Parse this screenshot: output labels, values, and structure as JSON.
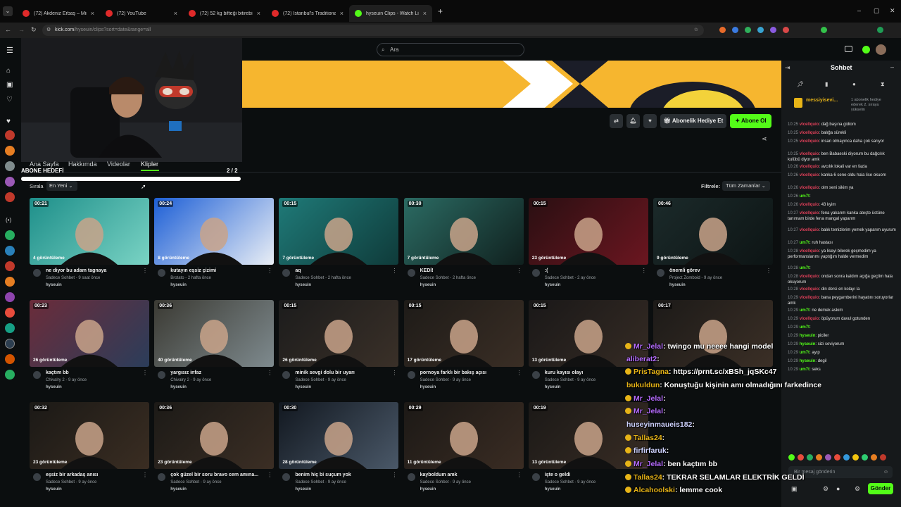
{
  "browser": {
    "tabs": [
      {
        "label": "(72) Akdeniz Erbaş – Miraçlam..",
        "icon": "youtube-icon"
      },
      {
        "label": "(72) YouTube",
        "icon": "youtube-icon"
      },
      {
        "label": "(72) 52 kg bifteği bitirebilir mi..",
        "icon": "youtube-icon"
      },
      {
        "label": "(72) Istanbul's Traditional Dishe..",
        "icon": "youtube-icon"
      },
      {
        "label": "hyseuin Clips - Watch Live on K..",
        "icon": "kick-icon"
      }
    ],
    "url_host": "kick.com",
    "url_path": "/hyseuin/clips?sort=date&range=all"
  },
  "site": {
    "search_placeholder": "Ara"
  },
  "channel": {
    "tabs": [
      "Ana Sayfa",
      "Hakkımda",
      "Videolar",
      "Klipler"
    ],
    "active_tab": "Klipler",
    "sub_goal_label": "ABONE HEDEFİ",
    "sub_goal_count": "2 / 2",
    "sub_goal_progress": 1.0,
    "gift_button": "Abonelik Hediye Et",
    "subscribe_button": "Abone Ol",
    "sort_label": "Sırala",
    "sort_value": "En Yeni",
    "filter_label": "Filtrele:",
    "filter_value": "Tüm Zamanlar"
  },
  "clips": [
    {
      "duration": "00:21",
      "views": "4 görüntüleme",
      "title": "ne diyor bu adam tagnaya",
      "meta": "Sadece Sohbet - 9 saat önce",
      "user": "hyseuin"
    },
    {
      "duration": "00:24",
      "views": "8 görüntüleme",
      "title": "kutayın eşsiz çizimi",
      "meta": "Brotato - 2 hafta önce",
      "user": "hyseuin"
    },
    {
      "duration": "00:15",
      "views": "7 görüntüleme",
      "title": "aq",
      "meta": "Sadece Sohbet - 2 hafta önce",
      "user": "hyseuin"
    },
    {
      "duration": "00:30",
      "views": "7 görüntüleme",
      "title": "KEDİ!",
      "meta": "Sadece Sohbet - 2 hafta önce",
      "user": "hyseuin"
    },
    {
      "duration": "00:15",
      "views": "23 görüntüleme",
      "title": ":(",
      "meta": "Sadece Sohbet - 2 ay önce",
      "user": "hyseuin"
    },
    {
      "duration": "00:46",
      "views": "9 görüntüleme",
      "title": "önemli görev",
      "meta": "Project Zomboid - 9 ay önce",
      "user": "hyseuin"
    },
    {
      "duration": "00:23",
      "views": "26 görüntüleme",
      "title": "kaçtım bb",
      "meta": "Chivalry 2 - 9 ay önce",
      "user": "hyseuin"
    },
    {
      "duration": "00:36",
      "views": "40 görüntüleme",
      "title": "yargısız infaz",
      "meta": "Chivalry 2 - 9 ay önce",
      "user": "hyseuin"
    },
    {
      "duration": "00:15",
      "views": "26 görüntüleme",
      "title": "minik sevgi dolu bir uyarı",
      "meta": "Sadece Sohbet - 9 ay önce",
      "user": "hyseuin"
    },
    {
      "duration": "00:15",
      "views": "17 görüntüleme",
      "title": "pornoya farklı bir bakış açısı",
      "meta": "Sadece Sohbet - 9 ay önce",
      "user": "hyseuin"
    },
    {
      "duration": "00:15",
      "views": "13 görüntüleme",
      "title": "kuru kayısı olayı",
      "meta": "Sadece Sohbet - 9 ay önce",
      "user": "hyseuin"
    },
    {
      "duration": "00:17",
      "views": "",
      "title": "",
      "meta": "",
      "user": ""
    },
    {
      "duration": "00:32",
      "views": "23 görüntüleme",
      "title": "eşsiz bir arkadaş anısı",
      "meta": "Sadece Sohbet - 9 ay önce",
      "user": "hyseuin"
    },
    {
      "duration": "00:36",
      "views": "23 görüntüleme",
      "title": "çok güzel bir soru bravo cem amına...",
      "meta": "Sadece Sohbet - 9 ay önce",
      "user": "hyseuin"
    },
    {
      "duration": "00:30",
      "views": "28 görüntüleme",
      "title": "benim hiç bi suçum yok",
      "meta": "Sadece Sohbet - 9 ay önce",
      "user": "hyseuin"
    },
    {
      "duration": "00:29",
      "views": "11 görüntüleme",
      "title": "kayboldum amk",
      "meta": "Sadece Sohbet - 9 ay önce",
      "user": "hyseuin"
    },
    {
      "duration": "00:19",
      "views": "13 görüntüleme",
      "title": "işte o geldi",
      "meta": "Sadece Sohbet - 9 ay önce",
      "user": "hyseuin"
    }
  ],
  "chat": {
    "title": "Sohbet",
    "top_gifter": "messiyisevi...",
    "top_gifter_note": "1 abonelik hediye ederek 2. sıraya yükselin",
    "messages": [
      {
        "time": "10:25",
        "user": "vlcellquio",
        "text": "dağ başına gidiom",
        "color": "#e0405a"
      },
      {
        "time": "10:25",
        "user": "vlcellquio",
        "text": "balığa sürekli",
        "color": "#e0405a"
      },
      {
        "time": "10:25",
        "user": "vlcellquio",
        "text": "insan olmayınca daha çok sarıyor",
        "color": "#e0405a"
      },
      {
        "time": "10:25",
        "user": "vlcellquio",
        "text": "ben Babaeski diyorum bu dağcılık kulübü diyor amk",
        "color": "#e0405a"
      },
      {
        "time": "10:26",
        "user": "vlcellquio",
        "text": "avcılık lokali var en fazla",
        "color": "#e0405a"
      },
      {
        "time": "10:26",
        "user": "vlcellquio",
        "text": "kanka 6 sene oldu hala lise okuom",
        "color": "#e0405a"
      },
      {
        "time": "10:26",
        "user": "vlcellquio",
        "text": "olm seni sikim ya",
        "color": "#e0405a"
      },
      {
        "time": "10:26",
        "user": "um7t",
        "text": "",
        "color": "#53fc18"
      },
      {
        "time": "10:26",
        "user": "vlcellquio",
        "text": "43 kyim",
        "color": "#e0405a"
      },
      {
        "time": "10:27",
        "user": "vlcellquio",
        "text": "fena yakarım kanka ateşte üstüne tanımam birde fena mangal yaparım",
        "color": "#e0405a"
      },
      {
        "time": "10:27",
        "user": "vlcellquio",
        "text": "balık temizlerim yemek yaparım uyurum",
        "color": "#e0405a"
      },
      {
        "time": "10:27",
        "user": "um7t",
        "text": "ruh hastası",
        "color": "#53fc18"
      },
      {
        "time": "10:28",
        "user": "vlcellquio",
        "text": "ya liseyi bilerek geçmedim ya performanslarımı yaptığım halde vermedim",
        "color": "#e0405a"
      },
      {
        "time": "10:28",
        "user": "um7t",
        "text": "",
        "color": "#53fc18"
      },
      {
        "time": "10:28",
        "user": "vlcellquio",
        "text": "ondan sonra kaldım açığa geçtim hala okuyorum",
        "color": "#e0405a"
      },
      {
        "time": "10:28",
        "user": "vlcellquio",
        "text": "din dersi en kolayı la",
        "color": "#e0405a"
      },
      {
        "time": "10:29",
        "user": "vlcellquio",
        "text": "bana peygamberini hayatını soruyorlar amk",
        "color": "#e0405a"
      },
      {
        "time": "10:29",
        "user": "um7t",
        "text": "ne demek askım",
        "color": "#53fc18"
      },
      {
        "time": "10:29",
        "user": "vlcellquio",
        "text": "öpüyorum davul gotunden",
        "color": "#e0405a"
      },
      {
        "time": "10:29",
        "user": "um7t",
        "text": "",
        "color": "#53fc18"
      },
      {
        "time": "10:29",
        "user": "hyseuin",
        "text": "piciler",
        "color": "#53fc18"
      },
      {
        "time": "10:29",
        "user": "hyseuin",
        "text": "sizi seviyorum",
        "color": "#53fc18"
      },
      {
        "time": "10:29",
        "user": "um7t",
        "text": "ayıp",
        "color": "#53fc18"
      },
      {
        "time": "10:29",
        "user": "hyseuin",
        "text": "degil",
        "color": "#53fc18"
      },
      {
        "time": "10:29",
        "user": "um7t",
        "text": "seks",
        "color": "#53fc18"
      }
    ],
    "input_placeholder": "Bir mesaj gönderin",
    "send_button": "Gönder"
  },
  "overlay_chat": [
    {
      "user": "Mr_Jelal",
      "text": ": twingo mu neeee hangi model",
      "color": "#b56cff",
      "badge": true
    },
    {
      "user": "aliberat2",
      "text": ":",
      "color": "#b56cff",
      "badge": false
    },
    {
      "user": "PrisTagna",
      "text": ": https://prnt.sc/xBSh_jqSKc47",
      "color": "#e7b417",
      "badge": true
    },
    {
      "user": "bukuldun",
      "text": ": Konuştuğu kişinin amı olmadığını farkedince",
      "color": "#e7b417",
      "badge": false
    },
    {
      "user": "Mr_Jelal",
      "text": ":",
      "color": "#b56cff",
      "badge": true
    },
    {
      "user": "Mr_Jelal",
      "text": ":",
      "color": "#b56cff",
      "badge": true
    },
    {
      "user": "huseyinmaueis182",
      "text": ":",
      "color": "#cfd3ff",
      "badge": false
    },
    {
      "user": "Tallas24",
      "text": ":",
      "color": "#e7b417",
      "badge": true
    },
    {
      "user": "firfirfaruk",
      "text": ":",
      "color": "#cfd3ff",
      "badge": true
    },
    {
      "user": "Mr_Jelal",
      "text": ": ben kaçtım bb",
      "color": "#b56cff",
      "badge": true
    },
    {
      "user": "Tallas24",
      "text": ": TEKRAR SELAMLAR ELEKTRİK GELDİ",
      "color": "#e7b417",
      "badge": true
    },
    {
      "user": "Alcahoolski",
      "text": ": lemme cook",
      "color": "#e7b417",
      "badge": true
    }
  ],
  "colors": {
    "accent": "#53fc18",
    "banner": "#f4b731",
    "bg": "#0b0e0f"
  }
}
